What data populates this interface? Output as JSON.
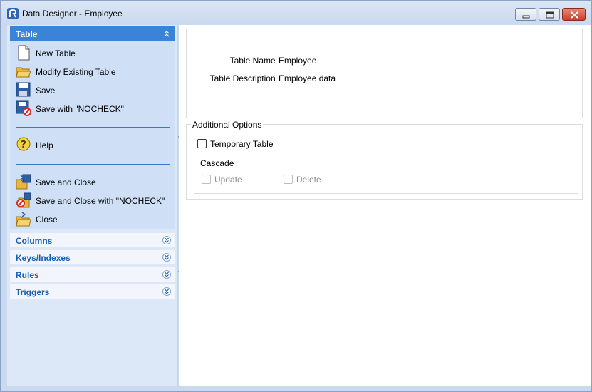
{
  "window": {
    "title": "Data Designer - Employee"
  },
  "nav": {
    "table_group": {
      "label": "Table",
      "tasks": [
        {
          "label": "New Table",
          "icon": "new-document-icon"
        },
        {
          "label": "Modify Existing Table",
          "icon": "open-folder-icon"
        },
        {
          "label": "Save",
          "icon": "save-disk-icon"
        },
        {
          "label": "Save with \"NOCHECK\"",
          "icon": "save-nocheck-icon"
        },
        {
          "label": "Help",
          "icon": "help-icon"
        },
        {
          "label": "Save and Close",
          "icon": "save-close-icon"
        },
        {
          "label": "Save and Close with \"NOCHECK\"",
          "icon": "save-close-nocheck-icon"
        },
        {
          "label": "Close",
          "icon": "close-folder-icon"
        }
      ]
    },
    "collapsed_groups": [
      {
        "label": "Columns"
      },
      {
        "label": "Keys/Indexes"
      },
      {
        "label": "Rules"
      },
      {
        "label": "Triggers"
      }
    ]
  },
  "form": {
    "table_name_label": "Table Name:",
    "table_name_value": "Employee",
    "table_description_label": "Table Description:",
    "table_description_value": "Employee data"
  },
  "options": {
    "legend": "Additional Options",
    "temporary_label": "Temporary Table",
    "temporary_checked": false,
    "cascade": {
      "legend": "Cascade",
      "update_label": "Update",
      "delete_label": "Delete"
    }
  },
  "colors": {
    "accent": "#3a83d6",
    "nav_bg": "#dce8f8",
    "group_text": "#1a5fb4"
  }
}
